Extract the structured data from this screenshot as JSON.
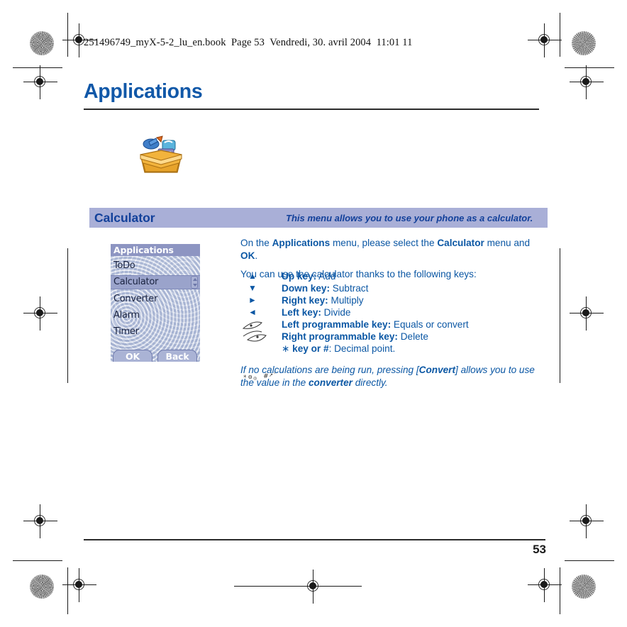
{
  "header": {
    "book_line": "251496749_myX-5-2_lu_en.book  Page 53  Vendredi, 30. avril 2004  11:01 11"
  },
  "title": "Applications",
  "app_icon": "toolbox-icon",
  "banner": {
    "title": "Calculator",
    "subtitle": "This menu allows you to use your phone as a calculator."
  },
  "phone_screen": {
    "title": "Applications",
    "items": [
      {
        "label": "ToDo",
        "selected": false
      },
      {
        "label": "Calculator",
        "selected": true
      },
      {
        "label": "Converter",
        "selected": false
      },
      {
        "label": "Alarm",
        "selected": false
      },
      {
        "label": "Timer",
        "selected": false
      }
    ],
    "softkey_left": "OK",
    "softkey_right": "Back"
  },
  "body": {
    "para1_a": "On the ",
    "para1_b": "Applications",
    "para1_c": " menu, please select the ",
    "para1_d": "Calculator",
    "para1_e": " menu and ",
    "para1_f": "OK",
    "para1_g": ".",
    "para2": "You can use the calculator thanks to the following keys:"
  },
  "keys": [
    {
      "glyph": "▲",
      "icon": "arrow-up-icon",
      "name": "Up key:",
      "desc": " Add"
    },
    {
      "glyph": "▼",
      "icon": "arrow-down-icon",
      "name": "Down key:",
      "desc": " Subtract"
    },
    {
      "glyph": "►",
      "icon": "arrow-right-icon",
      "name": "Right key:",
      "desc": " Multiply"
    },
    {
      "glyph": "◄",
      "icon": "arrow-left-icon",
      "name": "Left key:",
      "desc": " Divide"
    },
    {
      "glyph": "",
      "icon": "softkey-left-icon",
      "name": "Left programmable key:",
      "desc": " Equals or convert"
    },
    {
      "glyph": "",
      "icon": "softkey-right-icon",
      "name": "Right programmable key:",
      "desc": " Delete"
    },
    {
      "glyph": "",
      "icon": "star-hash-key-icon",
      "name": "key or #",
      "desc": ": Decimal point.",
      "prefix": "∗ "
    }
  ],
  "note": {
    "a": "If no calculations are being run, pressing [",
    "b": "Convert",
    "c": "] allows you to use the value in the ",
    "d": "converter",
    "e": " directly."
  },
  "footer": {
    "page_number": "53"
  },
  "colors": {
    "heading_blue": "#1158a8",
    "body_blue": "#0b57a4",
    "banner_bg": "#a9afd7",
    "banner_text": "#12409a",
    "phone_titlebar": "#8d95c2",
    "phone_selected": "#9aa3cb"
  }
}
